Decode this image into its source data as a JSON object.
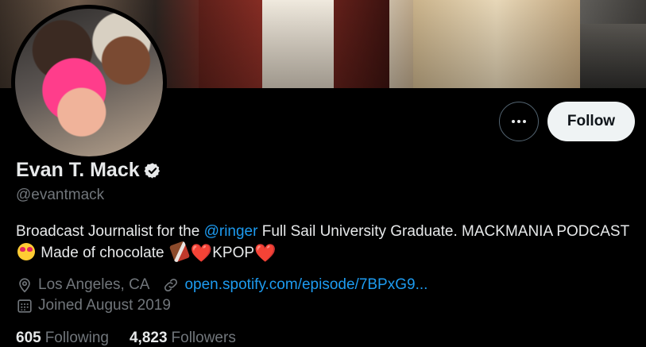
{
  "profile": {
    "display_name": "Evan T. Mack",
    "handle": "@evantmack",
    "verified": true,
    "bio": {
      "part1": "Broadcast Journalist for the ",
      "mention": "@ringer",
      "part2": " Full Sail University Graduate. MACKMANIA PODCAST",
      "part3": " Made of chocolate ",
      "heart1": "❤️",
      "part4": "KPOP",
      "heart2": "❤️"
    },
    "location": "Los Angeles, CA",
    "website": "open.spotify.com/episode/7BPxG9...",
    "joined": "Joined August 2019",
    "following_count": "605",
    "following_label": "Following",
    "followers_count": "4,823",
    "followers_label": "Followers"
  },
  "actions": {
    "follow_label": "Follow",
    "more_icon": "more-dots-icon"
  },
  "icons": {
    "verified": "verified-badge-icon",
    "location": "location-pin-icon",
    "link": "link-icon",
    "calendar": "calendar-icon"
  },
  "colors": {
    "background": "#000000",
    "text_primary": "#e7e9ea",
    "text_secondary": "#71767b",
    "accent": "#1d9bf0",
    "follow_button_bg": "#eff3f4"
  }
}
